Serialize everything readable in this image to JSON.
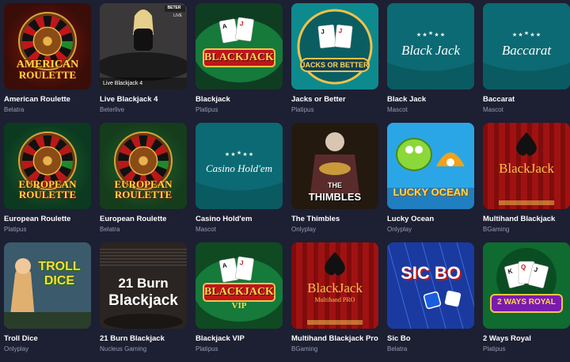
{
  "games": [
    {
      "title": "American Roulette",
      "provider": "Belatra",
      "art": "roulette-red",
      "logo_lines": [
        "AMERICAN",
        "ROULETTE"
      ],
      "bg": "#3a0d08"
    },
    {
      "title": "Live Blackjack 4",
      "provider": "Beterlive",
      "art": "live",
      "badge": "Live Blackjack 4",
      "brand": "BETER",
      "live": "LIVE",
      "bg": "#2c2a30"
    },
    {
      "title": "Blackjack",
      "provider": "Platipus",
      "art": "bj-green",
      "logo_lines": [
        "BLACKJACK"
      ],
      "bg": "#0f3d22"
    },
    {
      "title": "Jacks or Better",
      "provider": "Platipus",
      "art": "jacks",
      "logo_lines": [
        "JACKS OR BETTER"
      ],
      "bg": "#0a6f73"
    },
    {
      "title": "Black Jack",
      "provider": "Mascot",
      "art": "teal-script",
      "logo_lines": [
        "Black Jack"
      ],
      "bg": "#0b6a73"
    },
    {
      "title": "Baccarat",
      "provider": "Mascot",
      "art": "teal-script",
      "logo_lines": [
        "Baccarat"
      ],
      "bg": "#0b6a73"
    },
    {
      "title": "European Roulette",
      "provider": "Platipus",
      "art": "roulette-green",
      "logo_lines": [
        "EUROPEAN",
        "ROULETTE"
      ],
      "bg": "#0c3a20"
    },
    {
      "title": "European Roulette",
      "provider": "Belatra",
      "art": "roulette-green2",
      "logo_lines": [
        "EUROPEAN",
        "ROULETTE"
      ],
      "bg": "#153d1c"
    },
    {
      "title": "Casino Hold'em",
      "provider": "Mascot",
      "art": "teal-script",
      "logo_lines": [
        "Casino Hold'em"
      ],
      "bg": "#0b6a73"
    },
    {
      "title": "The Thimbles",
      "provider": "Onlyplay",
      "art": "thimbles",
      "logo_lines": [
        "THE",
        "THIMBLES"
      ],
      "bg": "#2a1c12"
    },
    {
      "title": "Lucky Ocean",
      "provider": "Onlyplay",
      "art": "ocean",
      "logo_lines": [
        "LUCKY OCEAN"
      ],
      "bg": "#1a8fd0"
    },
    {
      "title": "Multihand Blackjack",
      "provider": "BGaming",
      "art": "curtain",
      "logo_lines": [
        "BlackJack"
      ],
      "bg": "#8a0c0c"
    },
    {
      "title": "Troll Dice",
      "provider": "Onlyplay",
      "art": "troll",
      "logo_lines": [
        "TROLL",
        "DICE"
      ],
      "bg": "#2a4a5a"
    },
    {
      "title": "21 Burn Blackjack",
      "provider": "Nucleus Gaming",
      "art": "burn",
      "logo_lines": [
        "21 Burn",
        "Blackjack"
      ],
      "bg": "#2b2522"
    },
    {
      "title": "Blackjack VIP",
      "provider": "Platipus",
      "art": "bj-vip",
      "logo_lines": [
        "BLACKJACK",
        "VIP"
      ],
      "bg": "#0f4a22"
    },
    {
      "title": "Multihand Blackjack Pro",
      "provider": "BGaming",
      "art": "curtain",
      "logo_lines": [
        "BlackJack",
        "Multihand PRO"
      ],
      "bg": "#8a0c0c"
    },
    {
      "title": "Sic Bo",
      "provider": "Belatra",
      "art": "sicbo",
      "logo_lines": [
        "SIC BO"
      ],
      "bg": "#1d3fa8"
    },
    {
      "title": "2 Ways Royal",
      "provider": "Platipus",
      "art": "royal",
      "logo_lines": [
        "2 WAYS ROYAL"
      ],
      "bg": "#0f5c2a"
    }
  ],
  "colors": {
    "page_bg": "#1d1f33",
    "title": "#ffffff",
    "provider": "#9a9bb0"
  }
}
